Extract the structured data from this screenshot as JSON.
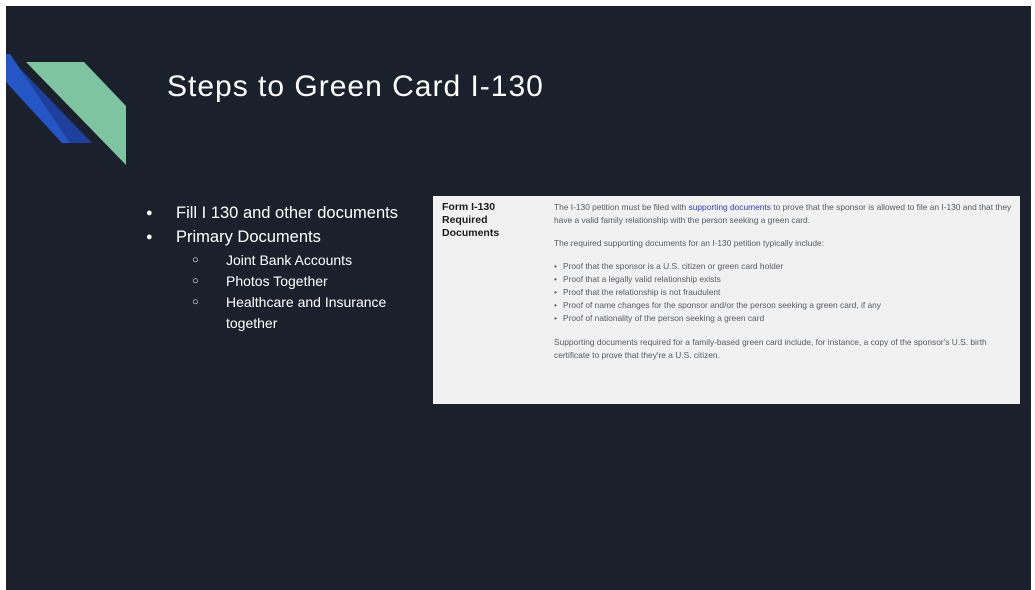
{
  "slide": {
    "title": "Steps to Green Card I-130",
    "accent_colors": {
      "dark_blue": "#1f3f9c",
      "bright_blue": "#2457c5",
      "teal": "#7ec4a1"
    }
  },
  "bullets": {
    "items": [
      {
        "text": "Fill I 130 and other documents"
      },
      {
        "text": "Primary Documents",
        "sub": [
          "Joint Bank Accounts",
          "Photos Together",
          "Healthcare and Insurance together"
        ]
      }
    ]
  },
  "screenshot": {
    "heading": "Form I-130 Required Documents",
    "intro_before_link": "The I-130 petition must be filed with ",
    "intro_link": "supporting documents",
    "intro_after_link": " to prove that the sponsor is allowed to file an I-130 and that they have a valid family relationship with the person seeking a green card.",
    "subheading": "The required supporting documents for an I-130 petition typically include:",
    "requirements": [
      "Proof that the sponsor is a U.S. citizen or green card holder",
      "Proof that a legally valid relationship exists",
      "Proof that the relationship is not fraudulent",
      "Proof of name changes for the sponsor and/or the person seeking a green card, if any",
      "Proof of nationality of the person seeking a green card"
    ],
    "closing": "Supporting documents required for a family-based green card include, for instance, a copy of the sponsor's U.S. birth certificate to prove that they're a U.S. citizen."
  }
}
